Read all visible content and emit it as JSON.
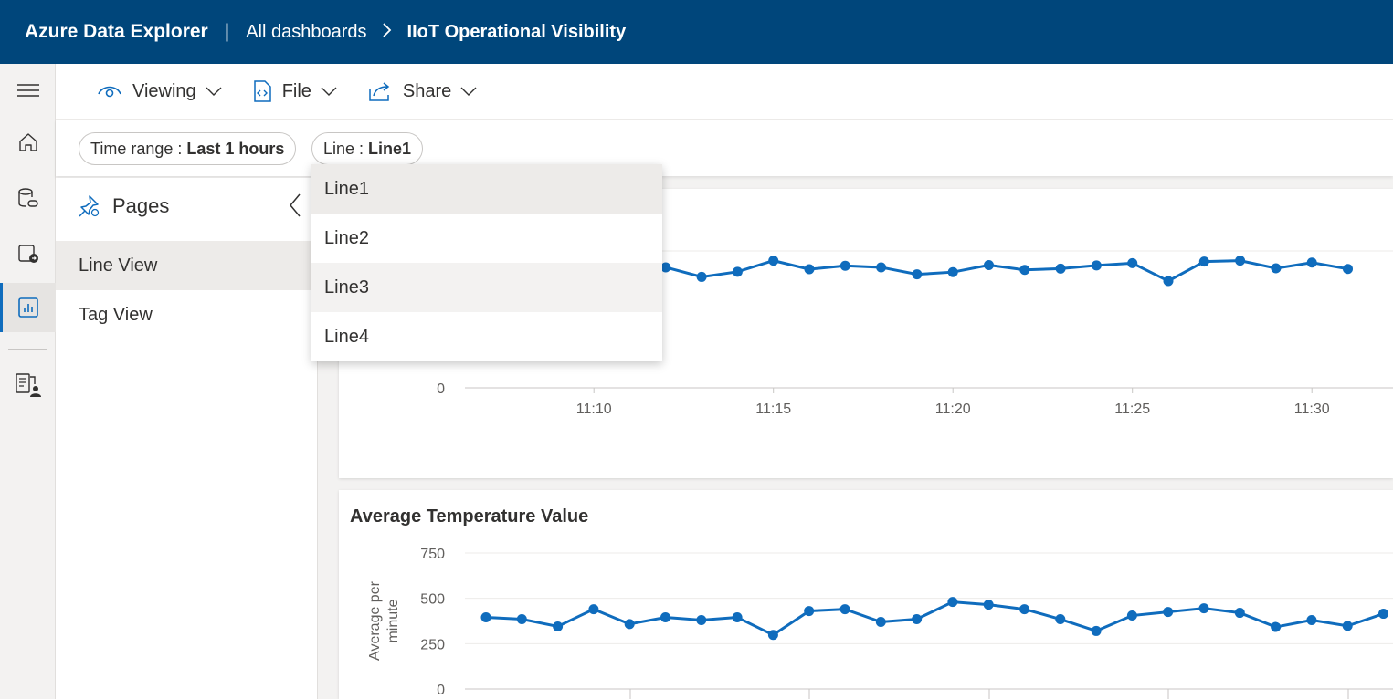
{
  "header": {
    "app_title": "Azure Data Explorer",
    "separator": "|",
    "breadcrumb_root": "All dashboards",
    "breadcrumb_current": "IIoT Operational Visibility"
  },
  "toolbar": {
    "viewing_label": "Viewing",
    "file_label": "File",
    "share_label": "Share"
  },
  "filters": {
    "time_range": {
      "name": "Time range",
      "value": "Last 1 hours"
    },
    "line": {
      "name": "Line",
      "value": "Line1"
    }
  },
  "pages_panel": {
    "title": "Pages",
    "items": [
      {
        "label": "Line View",
        "selected": true
      },
      {
        "label": "Tag View",
        "selected": false
      }
    ]
  },
  "line_dropdown": {
    "options": [
      "Line1",
      "Line2",
      "Line3",
      "Line4"
    ],
    "selected": "Line1"
  },
  "colors": {
    "header_bg": "#00467b",
    "accent": "#0f6cbd",
    "series": "#0f6cbd"
  },
  "chart_data": [
    {
      "type": "line",
      "title": "",
      "xlabel": "",
      "ylabel": "",
      "x_ticks": [
        "11:10",
        "11:15",
        "11:20",
        "11:25",
        "11:30"
      ],
      "y_ticks": [
        "0"
      ],
      "ylim": [
        0,
        750
      ],
      "grid": true,
      "x": [
        "11:06",
        "11:07",
        "11:08",
        "11:09",
        "11:10",
        "11:11",
        "11:12",
        "11:13",
        "11:14",
        "11:15",
        "11:16",
        "11:17",
        "11:18",
        "11:19",
        "11:20",
        "11:21",
        "11:22",
        "11:23",
        "11:24",
        "11:25",
        "11:26",
        "11:27",
        "11:28",
        "11:29",
        "11:30",
        "11:31"
      ],
      "series": [
        {
          "values": [
            null,
            null,
            null,
            null,
            null,
            358,
            378,
            348,
            364,
            399,
            372,
            383,
            378,
            356,
            363,
            385,
            370,
            374,
            384,
            391,
            335,
            396,
            399,
            375,
            393,
            373
          ]
        }
      ]
    },
    {
      "type": "line",
      "title": "Average Temperature Value",
      "xlabel": "",
      "ylabel": "Average per minute",
      "y_ticks": [
        "0",
        "250",
        "500",
        "750"
      ],
      "ylim": [
        0,
        750
      ],
      "grid": true,
      "x": [
        "11:06",
        "11:07",
        "11:08",
        "11:09",
        "11:10",
        "11:11",
        "11:12",
        "11:13",
        "11:14",
        "11:15",
        "11:16",
        "11:17",
        "11:18",
        "11:19",
        "11:20",
        "11:21",
        "11:22",
        "11:23",
        "11:24",
        "11:25",
        "11:26",
        "11:27",
        "11:28",
        "11:29",
        "11:30",
        "11:31"
      ],
      "series": [
        {
          "values": [
            395,
            385,
            345,
            440,
            358,
            395,
            380,
            395,
            298,
            430,
            440,
            370,
            385,
            480,
            465,
            440,
            385,
            320,
            405,
            425,
            445,
            420,
            342,
            380,
            348,
            415
          ]
        }
      ]
    }
  ]
}
